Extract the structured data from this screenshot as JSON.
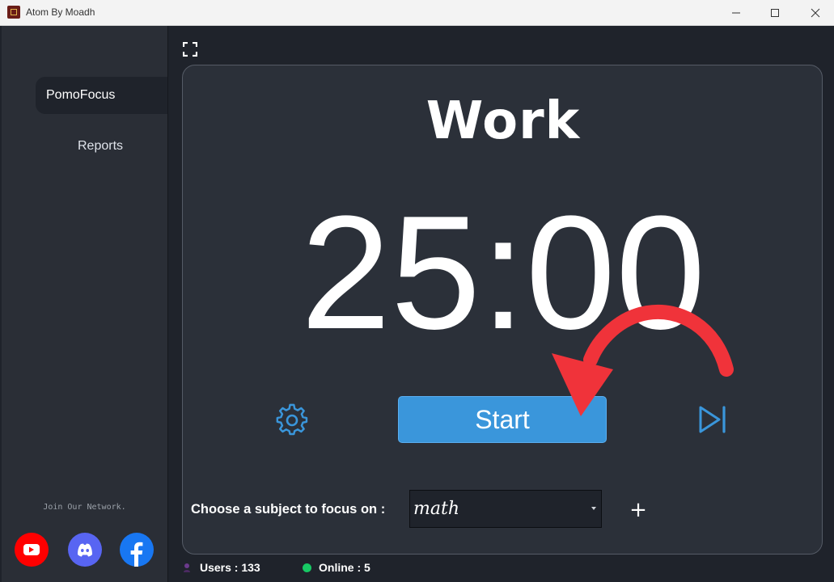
{
  "window": {
    "title": "Atom By Moadh"
  },
  "sidebar": {
    "items": [
      {
        "label": "PomoFocus",
        "active": true
      },
      {
        "label": "Reports",
        "active": false
      }
    ],
    "network_label": "Join Our Network.",
    "socials": [
      {
        "name": "youtube-icon",
        "color": "#ff0000"
      },
      {
        "name": "discord-icon",
        "color": "#5865f2"
      },
      {
        "name": "facebook-icon",
        "color": "#1877f2"
      }
    ]
  },
  "timer": {
    "mode": "Work",
    "time": "25:00",
    "start_label": "Start"
  },
  "subject": {
    "label": "Choose a subject to focus on :",
    "selected": "math"
  },
  "status": {
    "users": "Users : 133",
    "online": "Online : 5"
  },
  "colors": {
    "accent": "#3a96db",
    "online_dot": "#17c964",
    "annotation_arrow": "#f0333a"
  }
}
